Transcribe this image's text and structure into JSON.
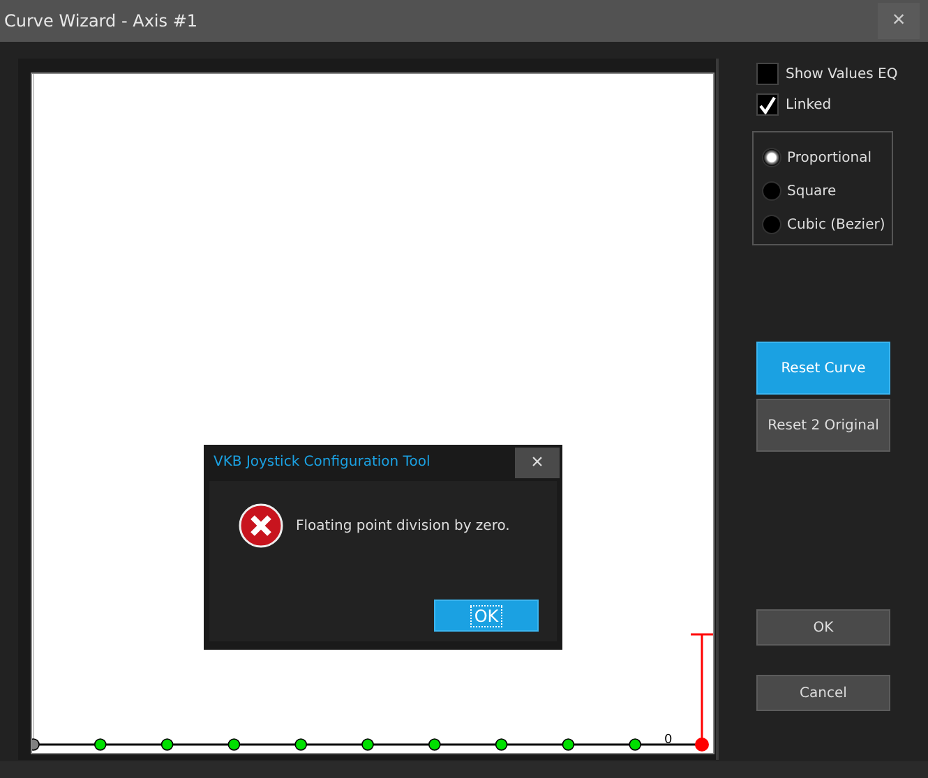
{
  "window": {
    "title": "Curve Wizard - Axis #1",
    "close": "×"
  },
  "curve": {
    "points": [
      {
        "color": "#808080"
      },
      {
        "color": "#00e000"
      },
      {
        "color": "#00e000"
      },
      {
        "color": "#00e000"
      },
      {
        "color": "#00e000"
      },
      {
        "color": "#00e000"
      },
      {
        "color": "#00e000"
      },
      {
        "color": "#00e000"
      },
      {
        "color": "#00e000"
      },
      {
        "color": "#00e000"
      },
      {
        "color": "#ff0000"
      }
    ],
    "axis_label": "0"
  },
  "options": [
    {
      "label": "Show Values EQ",
      "checked": false
    },
    {
      "label": "Linked",
      "checked": true
    }
  ],
  "modes": [
    {
      "label": "Proportional",
      "selected": true
    },
    {
      "label": "Square",
      "selected": false
    },
    {
      "label": "Cubic (Bezier)",
      "selected": false
    }
  ],
  "actions": [
    {
      "label": "Reset Curve",
      "primary": true
    },
    {
      "label": "Reset 2 Original",
      "primary": false
    }
  ],
  "footer_buttons": [
    "OK",
    "Cancel"
  ],
  "dialog": {
    "title": "VKB Joystick Configuration Tool",
    "close": "×",
    "message": "Floating point division by zero.",
    "button": "OK"
  }
}
